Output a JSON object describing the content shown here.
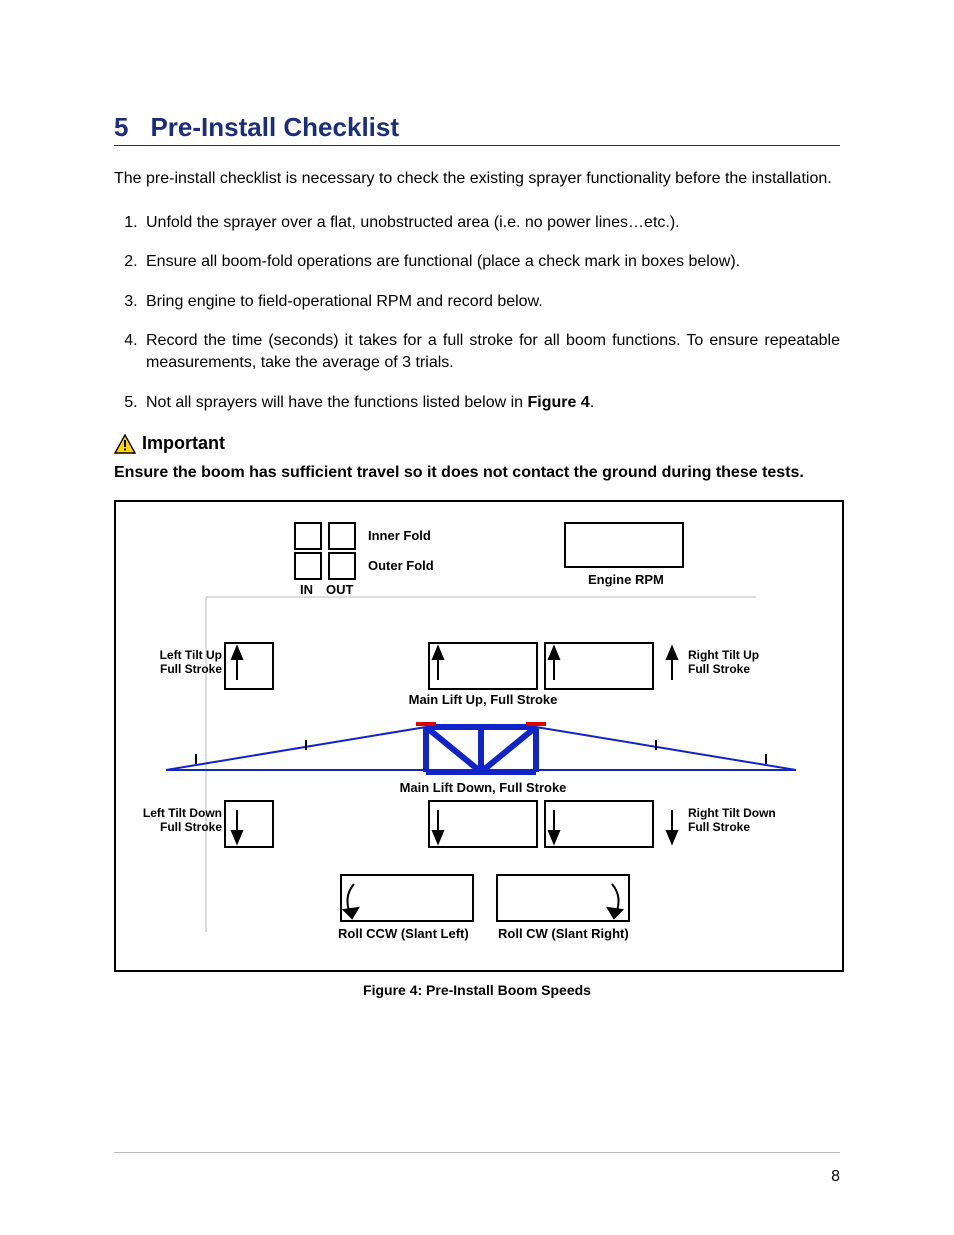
{
  "heading": {
    "number": "5",
    "title": "Pre-Install Checklist"
  },
  "intro": "The pre-install checklist is necessary to check the existing sprayer functionality before the installation.",
  "steps": [
    "Unfold the sprayer over a flat, unobstructed area (i.e. no power lines…etc.).",
    "Ensure all boom-fold operations are functional (place a check mark in boxes below).",
    "Bring engine to field-operational RPM and record below.",
    "Record the time (seconds) it takes for a full stroke for all boom functions.  To ensure repeatable measurements, take the average of 3 trials.",
    "Not all sprayers will have the functions listed below in "
  ],
  "figure_ref": "Figure 4",
  "step5_tail": ".",
  "important_label": "Important",
  "important_body": "Ensure the boom has sufficient travel so it does not contact the ground during these tests.",
  "figure": {
    "fold": {
      "inner": "Inner Fold",
      "outer": "Outer Fold",
      "in": "IN",
      "out": "OUT"
    },
    "engine": "Engine RPM",
    "lt_up": "Left Tilt Up\nFull Stroke",
    "lt_dn": "Left Tilt Down\nFull Stroke",
    "rt_up": "Right Tilt Up\nFull Stroke",
    "rt_dn": "Right Tilt  Down\nFull Stroke",
    "main_up": "Main Lift Up, Full Stroke",
    "main_dn": "Main Lift Down, Full Stroke",
    "roll_ccw": "Roll CCW (Slant Left)",
    "roll_cw": "Roll CW (Slant Right)"
  },
  "caption": "Figure 4: Pre-Install Boom Speeds",
  "page_number": "8"
}
